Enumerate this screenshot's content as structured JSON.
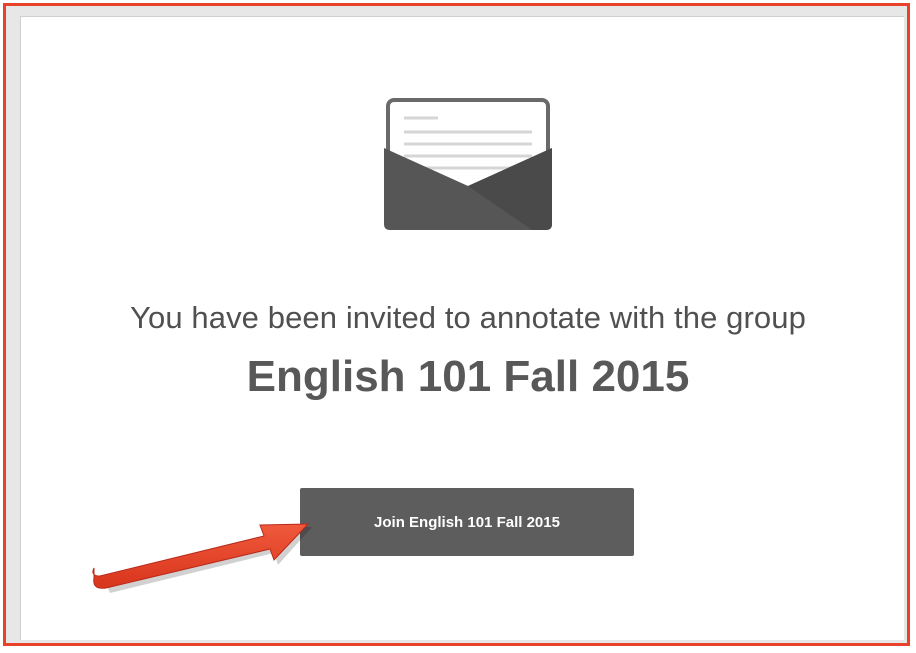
{
  "invite": {
    "message": "You have been invited to annotate with the group",
    "group_name": "English 101 Fall 2015",
    "join_button_label": "Join English 101 Fall 2015"
  },
  "icons": {
    "envelope": "open-envelope-icon",
    "arrow": "red-arrow-annotation"
  },
  "colors": {
    "frame_border": "#e8432a",
    "button_bg": "#5d5d5d",
    "text": "#505050",
    "arrow": "#e8432a"
  }
}
